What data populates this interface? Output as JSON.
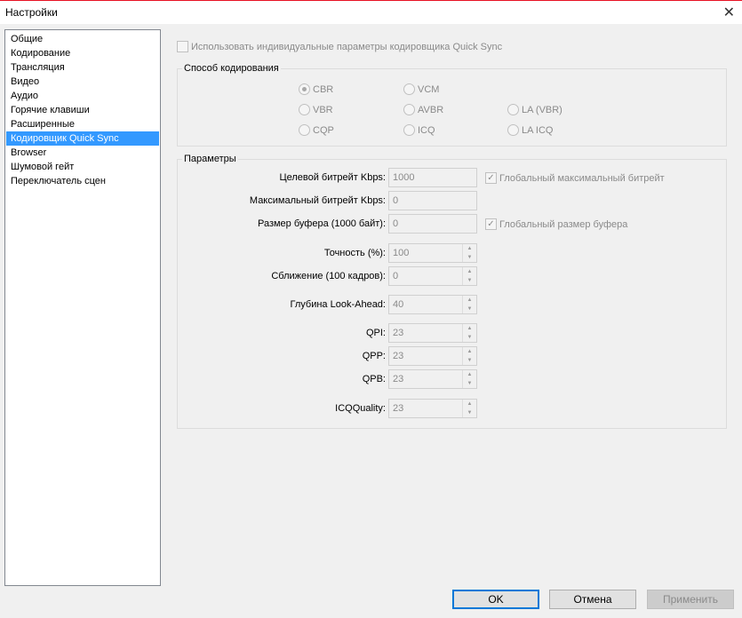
{
  "window": {
    "title": "Настройки"
  },
  "sidebar": {
    "items": [
      "Общие",
      "Кодирование",
      "Трансляция",
      "Видео",
      "Аудио",
      "Горячие клавиши",
      "Расширенные",
      "Кодировщик Quick Sync",
      "Browser",
      "Шумовой гейт",
      "Переключатель сцен"
    ],
    "selected": 7
  },
  "main": {
    "use_custom_label": "Использовать индивидуальные параметры кодировщика Quick Sync",
    "encoding_group": {
      "title": "Способ кодирования",
      "options": [
        "CBR",
        "VCM",
        "VBR",
        "AVBR",
        "LA (VBR)",
        "CQP",
        "ICQ",
        "LA ICQ"
      ],
      "selected": "CBR"
    },
    "params_group": {
      "title": "Параметры",
      "target_bitrate": {
        "label": "Целевой битрейт Kbps:",
        "value": "1000"
      },
      "max_bitrate": {
        "label": "Максимальный битрейт Kbps:",
        "value": "0"
      },
      "buffer_size": {
        "label": "Размер буфера (1000 байт):",
        "value": "0"
      },
      "global_max_bitrate": "Глобальный максимальный битрейт",
      "global_buffer": "Глобальный размер буфера",
      "accuracy": {
        "label": "Точность (%):",
        "value": "100"
      },
      "convergence": {
        "label": "Сближение (100 кадров):",
        "value": "0"
      },
      "lookahead": {
        "label": "Глубина Look-Ahead:",
        "value": "40"
      },
      "qpi": {
        "label": "QPI:",
        "value": "23"
      },
      "qpp": {
        "label": "QPP:",
        "value": "23"
      },
      "qpb": {
        "label": "QPB:",
        "value": "23"
      },
      "icq": {
        "label": "ICQQuality:",
        "value": "23"
      }
    }
  },
  "buttons": {
    "ok": "OK",
    "cancel": "Отмена",
    "apply": "Применить"
  }
}
